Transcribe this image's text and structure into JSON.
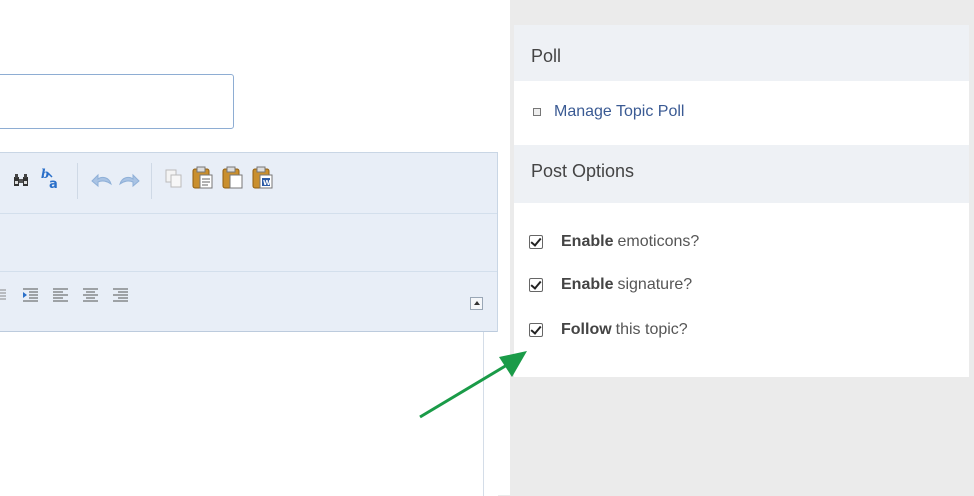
{
  "editor": {
    "toolbar_icons": [
      "find-icon",
      "replace-icon",
      "undo-icon",
      "redo-icon",
      "copy-icon",
      "paste-icon",
      "paste-text-icon",
      "paste-word-icon"
    ],
    "align_icons": [
      "indent-icon",
      "align-left-icon",
      "align-center-icon",
      "align-right-icon"
    ]
  },
  "poll": {
    "heading": "Poll",
    "manage_label": "Manage Topic Poll"
  },
  "post_options": {
    "heading": "Post Options",
    "options": [
      {
        "bold": "Enable",
        "rest": "emoticons?",
        "checked": true
      },
      {
        "bold": "Enable",
        "rest": "signature?",
        "checked": true
      },
      {
        "bold": "Follow",
        "rest": "this topic?",
        "checked": true
      }
    ]
  },
  "colors": {
    "annotation_arrow": "#1a9b48",
    "link": "#3a5a93"
  }
}
